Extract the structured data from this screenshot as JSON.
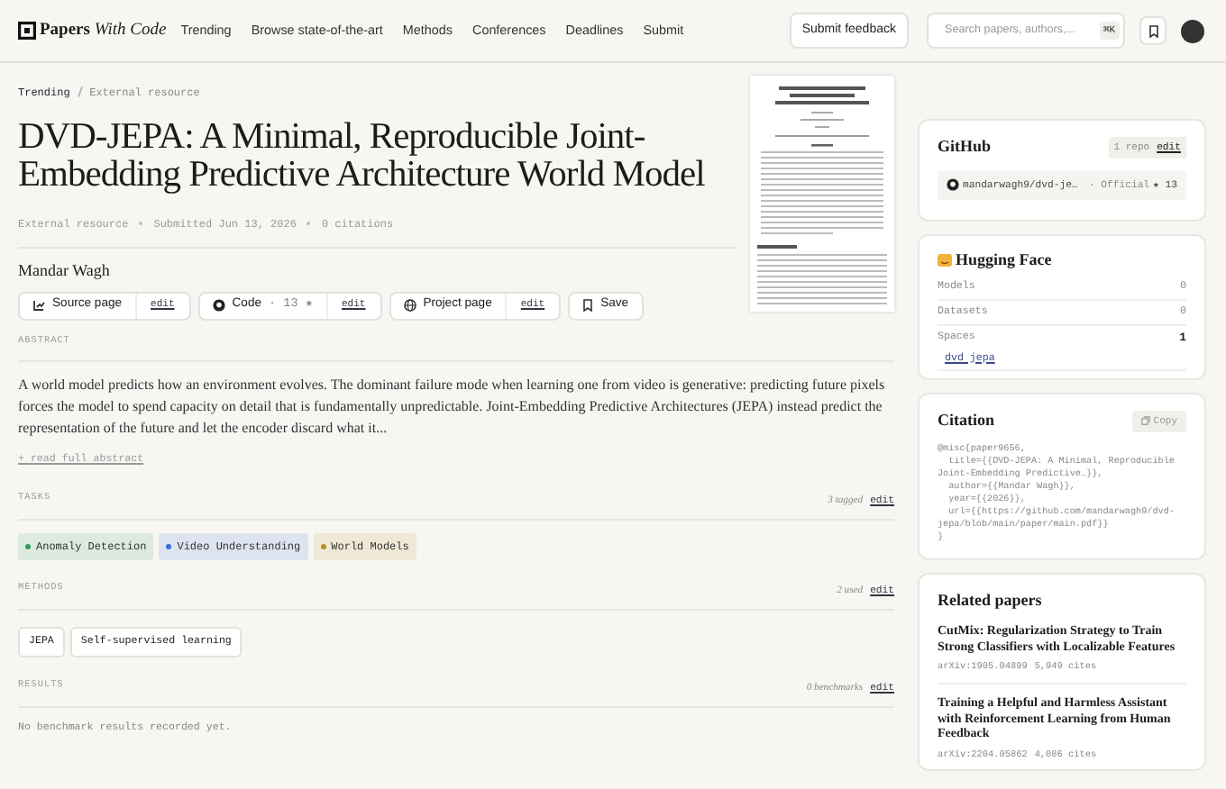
{
  "header": {
    "logo": "Papers *With Code*",
    "nav": [
      "Trending",
      "Browse state-of-the-art",
      "Methods",
      "Conferences",
      "Deadlines",
      "Submit"
    ],
    "feedback_button": "Submit feedback",
    "search": {
      "placeholder": "Search papers, authors,...",
      "shortcut": "⌘K"
    }
  },
  "breadcrumb": [
    "Trending",
    "External resource"
  ],
  "paper": {
    "title": "DVD-JEPA: A Minimal, Reproducible Joint-Embedding Predictive Architecture World Model",
    "meta": [
      "External resource",
      "Submitted Jun 13, 2026",
      "0 citations"
    ],
    "author": "Mandar Wagh",
    "actions": [
      {
        "kind": "source",
        "label": "Source page",
        "edit": "edit"
      },
      {
        "kind": "code",
        "label": "Code",
        "count": "· 13 ★",
        "edit": "edit"
      },
      {
        "kind": "project",
        "label": "Project page",
        "edit": "edit"
      },
      {
        "kind": "save",
        "label": "Save"
      }
    ]
  },
  "abstract": {
    "heading": "ABSTRACT",
    "text": "A world model predicts how an environment evolves. The dominant failure mode when learning one from video is generative: predicting future pixels forces the model to spend capacity on detail that is fundamentally unpredictable. Joint-Embedding Predictive Architectures (JEPA) instead predict the representation of the future and let the encoder discard what it...",
    "more": "+ read full abstract"
  },
  "tasks": {
    "heading": "TASKS",
    "count": "3 tagged",
    "edit": "edit",
    "items": [
      {
        "label": "Anomaly Detection",
        "color": "#2f9a63"
      },
      {
        "label": "Video Understanding",
        "color": "#3d6fd6"
      },
      {
        "label": "World Models",
        "color": "#b8901e"
      }
    ]
  },
  "methods": {
    "heading": "METHODS",
    "count": "2 used",
    "edit": "edit",
    "items": [
      "JEPA",
      "Self-supervised learning"
    ]
  },
  "results": {
    "heading": "RESULTS",
    "count": "0 benchmarks",
    "edit": "edit",
    "empty": "No benchmark results recorded yet."
  },
  "sidebar": {
    "github": {
      "title": "GitHub",
      "count": "1 repo",
      "edit": "edit",
      "repo": {
        "name": "mandarwagh9/dvd-je…",
        "badge": "· Official",
        "stars": "★ 13"
      }
    },
    "hugging_face": {
      "title": "Hugging Face",
      "rows": [
        {
          "label": "Models",
          "value": "0"
        },
        {
          "label": "Datasets",
          "value": "0"
        },
        {
          "label": "Spaces",
          "value": "1",
          "items": [
            "dvd jepa"
          ]
        }
      ]
    },
    "citation": {
      "title": "Citation",
      "copy": "Copy",
      "lines": [
        "@misc{paper9656,",
        "  title={{DVD-JEPA: A Minimal, Reproducible",
        "Joint-Embedding Predictive…}},",
        "  author={{Mandar Wagh}},",
        "  year={{2026}},",
        "  url={{https://github.com/mandarwagh9/dvd-",
        "jepa/blob/main/paper/main.pdf}}",
        "}"
      ]
    },
    "related": {
      "title": "Related papers",
      "items": [
        {
          "title": "CutMix: Regularization Strategy to Train Strong Classifiers with Localizable Features",
          "id": "arXiv:1905.04899",
          "cites": "5,949 cites"
        },
        {
          "title": "Training a Helpful and Harmless Assistant with Reinforcement Learning from Human Feedback",
          "id": "arXiv:2204.05862",
          "cites": "4,086 cites"
        }
      ]
    }
  }
}
